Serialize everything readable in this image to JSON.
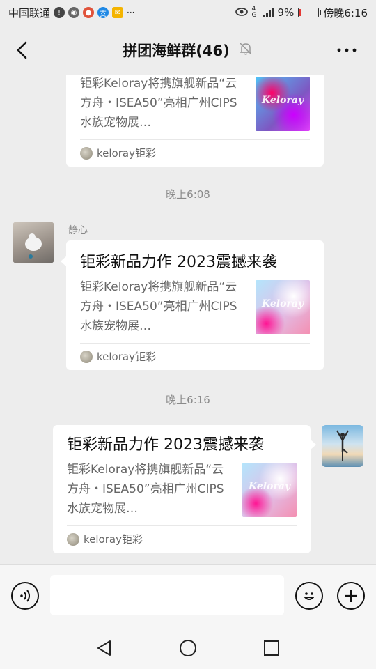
{
  "status_bar": {
    "carrier": "中国联通",
    "battery": "9%",
    "battery_level": 0.09,
    "time": "傍晚6:16",
    "more": "···",
    "network": "4G"
  },
  "header": {
    "title": "拼团海鲜群(46)"
  },
  "messages": [
    {
      "title": "",
      "description": "钜彩Keloray将携旗舰新品“云方舟・ISEA50”亮相广州CIPS水族宠物展…",
      "thumb_text": "Keloray",
      "source": "keloray钜彩"
    },
    {
      "time": "晚上6:08",
      "sender": "静心",
      "title": "钜彩新品力作 2023震撼来袭",
      "description": "钜彩Keloray将携旗舰新品“云方舟・ISEA50”亮相广州CIPS水族宠物展…",
      "thumb_text": "Keloray",
      "source": "keloray钜彩"
    },
    {
      "time": "晚上6:16",
      "title": "钜彩新品力作 2023震撼来袭",
      "description": "钜彩Keloray将携旗舰新品“云方舟・ISEA50”亮相广州CIPS水族宠物展…",
      "thumb_text": "Keloray",
      "source": "keloray钜彩"
    }
  ],
  "input": {
    "value": "",
    "placeholder": ""
  },
  "colors": {
    "background": "#ededed",
    "bubble": "#ffffff",
    "battery_low": "#e53935"
  }
}
